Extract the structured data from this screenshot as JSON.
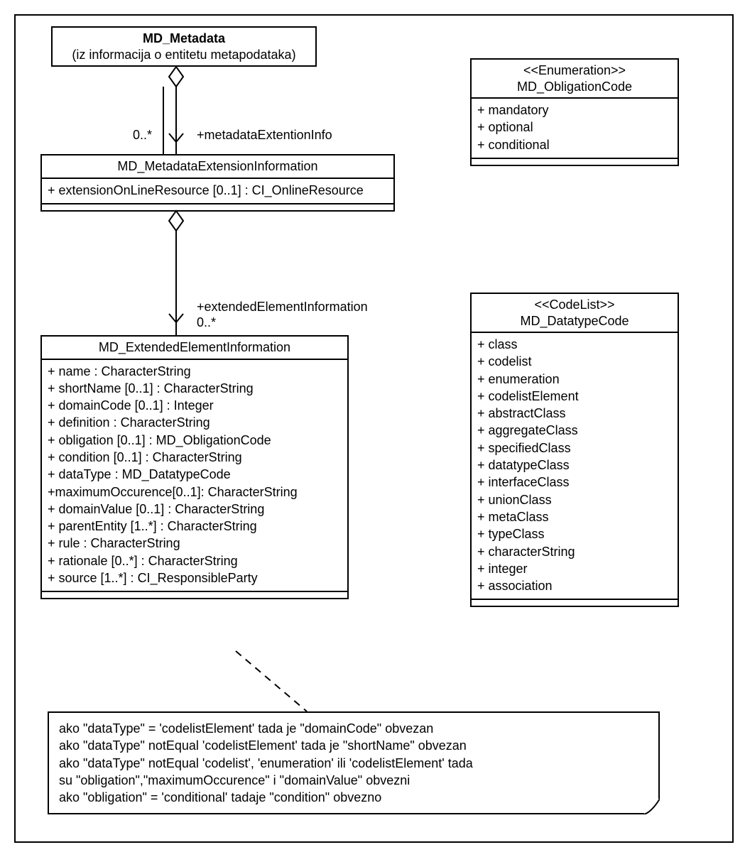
{
  "classes": {
    "metadata": {
      "title": "MD_Metadata",
      "subtitle": "(iz informacija o entitetu metapodataka)"
    },
    "extInfo": {
      "title": "MD_MetadataExtensionInformation",
      "attrs": [
        "+ extensionOnLineResource [0..1] : CI_OnlineResource"
      ]
    },
    "extElem": {
      "title": "MD_ExtendedElementInformation",
      "attrs": [
        "+ name : CharacterString",
        "+ shortName [0..1] : CharacterString",
        "+ domainCode [0..1] : Integer",
        "+ definition : CharacterString",
        "+ obligation [0..1] : MD_ObligationCode",
        "+ condition [0..1] : CharacterString",
        "+ dataType : MD_DatatypeCode",
        "+maximumOccurence[0..1]: CharacterString",
        "+ domainValue [0..1] : CharacterString",
        "+ parentEntity [1..*] : CharacterString",
        "+ rule : CharacterString",
        "+ rationale [0..*] : CharacterString",
        "+ source [1..*] : CI_ResponsibleParty"
      ]
    },
    "obligation": {
      "stereo": "<<Enumeration>>",
      "title": "MD_ObligationCode",
      "attrs": [
        "+ mandatory",
        "+ optional",
        "+ conditional"
      ]
    },
    "datatype": {
      "stereo": "<<CodeList>>",
      "title": "MD_DatatypeCode",
      "attrs": [
        "+ class",
        "+ codelist",
        "+ enumeration",
        "+ codelistElement",
        "+ abstractClass",
        "+ aggregateClass",
        "+ specifiedClass",
        "+ datatypeClass",
        "+ interfaceClass",
        "+ unionClass",
        "+ metaClass",
        "+ typeClass",
        "+ characterString",
        "+ integer",
        "+ association"
      ]
    }
  },
  "assoc": {
    "a1": {
      "mult": "0..*",
      "role": "+metadataExtentionInfo"
    },
    "a2": {
      "role": "+extendedElementInformation",
      "mult": "0..*"
    }
  },
  "note": {
    "lines": [
      "ako \"dataType\" = 'codelistElement' tada je \"domainCode\" obvezan",
      "ako \"dataType\" notEqual 'codelistElement' tada je \"shortName\" obvezan",
      "ako \"dataType\" notEqual 'codelist', 'enumeration' ili 'codelistElement' tada",
      "su \"obligation\",\"maximumOccurence\" i \"domainValue\" obvezni",
      "ako \"obligation\" = 'conditional' tadaje \"condition\" obvezno"
    ]
  }
}
